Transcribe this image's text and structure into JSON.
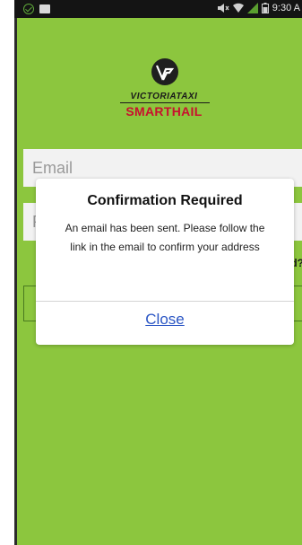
{
  "status_bar": {
    "time": "9:30 A",
    "left_icons": [
      "check-circle-icon",
      "shopping-bag-icon"
    ],
    "right_icons": [
      "mute-icon",
      "wifi-icon",
      "signal-icon",
      "battery-icon"
    ]
  },
  "brand": {
    "name": "VICTORIATAXI",
    "product": "SMARTHAIL",
    "colors": {
      "background": "#8cc63e",
      "logo_red": "#c8102e",
      "link_blue": "#2a55c4"
    }
  },
  "login_form": {
    "email_placeholder": "Email",
    "password_placeholder": "P",
    "partial_hint": "d?"
  },
  "dialog": {
    "title": "Confirmation Required",
    "message": "An email has been sent. Please follow the link in the email to confirm your address",
    "close_label": "Close"
  }
}
